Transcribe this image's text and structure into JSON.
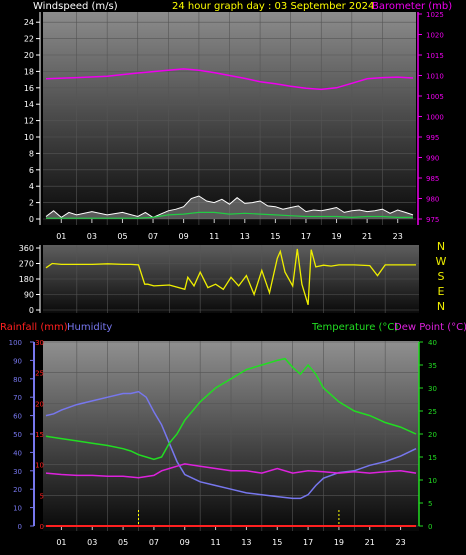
{
  "colors": {
    "wind": "#ffffff",
    "gust": "#ffffff",
    "gust_fill": "#7a7a7a",
    "wind_avg": "#22cc44",
    "barometer": "#ee00ee",
    "direction": "#eeee00",
    "rain": "#ff2020",
    "humidity": "#7777ee",
    "temperature": "#22dd22",
    "dewpoint": "#dd22dd",
    "grid": "#555555"
  },
  "chart_data": [
    {
      "type": "line",
      "title": "24 hour graph day : 03 September 2024",
      "ylabel_left": "Windspeed (m/s)",
      "ylabel_right": "Barometer (mb)",
      "ylim_left": [
        0,
        25
      ],
      "ylim_right": [
        975,
        1025
      ],
      "left_ticks": [
        "0",
        "2",
        "4",
        "6",
        "8",
        "10",
        "12",
        "14",
        "16",
        "18",
        "20",
        "22",
        "24"
      ],
      "right_ticks": [
        "975",
        "980",
        "985",
        "990",
        "995",
        "1000",
        "1005",
        "1010",
        "1015",
        "1020",
        "1025"
      ],
      "x_ticks": [
        "01",
        "03",
        "05",
        "07",
        "09",
        "11",
        "13",
        "15",
        "17",
        "19",
        "21",
        "23"
      ],
      "grid": true,
      "series": [
        {
          "key": "gust",
          "x": [
            0,
            0.5,
            1,
            1.5,
            2,
            3,
            4,
            5,
            6,
            6.5,
            7,
            7.5,
            8,
            8.5,
            9,
            9.5,
            10,
            10.5,
            11,
            11.5,
            12,
            12.5,
            13,
            13.5,
            14,
            14.5,
            15,
            15.5,
            16,
            16.5,
            17,
            17.5,
            18,
            18.5,
            19,
            19.5,
            20,
            20.5,
            21,
            21.5,
            22,
            22.5,
            23,
            23.5,
            24
          ],
          "values": [
            0.3,
            1,
            0.2,
            0.8,
            0.5,
            0.9,
            0.5,
            0.8,
            0.3,
            0.8,
            0.2,
            0.6,
            1,
            1.2,
            1.5,
            2.5,
            2.8,
            2.2,
            2,
            2.4,
            1.8,
            2.6,
            1.9,
            2,
            2.2,
            1.6,
            1.5,
            1.2,
            1.4,
            1.6,
            0.9,
            1.1,
            1,
            1.2,
            1.4,
            0.8,
            1,
            1.1,
            0.9,
            1,
            1.2,
            0.7,
            1.1,
            0.8,
            0.5
          ]
        },
        {
          "key": "wind_avg",
          "x": [
            0,
            2,
            4,
            6,
            7,
            8,
            9,
            10,
            11,
            12,
            13,
            14,
            15,
            16,
            17,
            18,
            19,
            20,
            21,
            22,
            23,
            24
          ],
          "values": [
            0.1,
            0.1,
            0.1,
            0.1,
            0.2,
            0.5,
            0.6,
            0.8,
            0.8,
            0.6,
            0.7,
            0.6,
            0.5,
            0.4,
            0.3,
            0.3,
            0.3,
            0.2,
            0.3,
            0.3,
            0.2,
            0.2
          ]
        },
        {
          "key": "barometer",
          "x": [
            0,
            2,
            4,
            6,
            8,
            9,
            10,
            11,
            12,
            13,
            14,
            15,
            16,
            17,
            18,
            19,
            20,
            21,
            22,
            23,
            24
          ],
          "values": [
            1009.2,
            1009.5,
            1009.8,
            1010.6,
            1011.3,
            1011.6,
            1011.3,
            1010.7,
            1010.0,
            1009.3,
            1008.5,
            1008.0,
            1007.4,
            1006.9,
            1006.6,
            1007.0,
            1008.1,
            1009.2,
            1009.5,
            1009.6,
            1009.4
          ]
        }
      ]
    },
    {
      "type": "line",
      "ylim": [
        0,
        360
      ],
      "y_ticks": [
        "0",
        "90",
        "180",
        "270",
        "360"
      ],
      "compass": [
        "N",
        "W",
        "S",
        "E",
        "N"
      ],
      "x_ticks": [],
      "series": [
        {
          "key": "direction",
          "x": [
            0,
            0.4,
            1,
            2,
            3,
            4,
            5,
            5.5,
            6,
            6.4,
            6.6,
            7,
            8,
            9,
            9.2,
            9.6,
            10,
            10.5,
            11,
            11.5,
            12,
            12.5,
            13,
            13.5,
            14,
            14.5,
            15,
            15.2,
            15.5,
            16,
            16.3,
            16.6,
            17,
            17.2,
            17.5,
            18,
            18.5,
            19,
            20,
            21,
            21.5,
            22,
            23,
            24
          ],
          "values": [
            245,
            270,
            265,
            265,
            265,
            268,
            265,
            265,
            262,
            150,
            150,
            140,
            145,
            120,
            190,
            140,
            220,
            130,
            150,
            120,
            190,
            140,
            200,
            90,
            230,
            100,
            300,
            340,
            220,
            140,
            355,
            150,
            30,
            350,
            250,
            260,
            255,
            262,
            262,
            258,
            200,
            262,
            262,
            262
          ]
        }
      ]
    },
    {
      "type": "line",
      "ylabel_left": "Rainfall (mm)",
      "ylabel_humidity": "Humidity",
      "ylabel_right": "Temperature (°C)",
      "ylabel_dew": "Dew Point (°C)",
      "ylim_humidity": [
        0,
        100
      ],
      "ylim_rain": [
        0,
        30
      ],
      "ylim_temp": [
        0,
        40
      ],
      "humidity_ticks": [
        "0",
        "10",
        "20",
        "30",
        "40",
        "50",
        "60",
        "70",
        "80",
        "90",
        "100"
      ],
      "rain_ticks": [
        "0",
        "5",
        "10",
        "15",
        "20",
        "25",
        "30"
      ],
      "temp_ticks": [
        "0",
        "5",
        "10",
        "15",
        "20",
        "25",
        "30",
        "35",
        "40"
      ],
      "x_ticks": [
        "01",
        "03",
        "05",
        "07",
        "09",
        "11",
        "13",
        "15",
        "17",
        "19",
        "21",
        "23"
      ],
      "series": [
        {
          "key": "humidity",
          "x": [
            0,
            0.5,
            1,
            2,
            3,
            4,
            5,
            5.5,
            6,
            6.5,
            7,
            7.5,
            8,
            8.5,
            9,
            10,
            11,
            12,
            13,
            14,
            15,
            16,
            16.5,
            17,
            17.5,
            18,
            19,
            20,
            21,
            22,
            23,
            24
          ],
          "values": [
            60,
            61,
            63,
            66,
            68,
            70,
            72,
            72,
            73,
            70,
            62,
            55,
            45,
            35,
            28,
            24,
            22,
            20,
            18,
            17,
            16,
            15,
            15,
            17,
            22,
            26,
            29,
            30,
            33,
            35,
            38,
            42
          ]
        },
        {
          "key": "temperature",
          "x": [
            0,
            1,
            2,
            3,
            4,
            5,
            5.5,
            6,
            6.5,
            7,
            7.5,
            8,
            8.5,
            9,
            10,
            11,
            12,
            13,
            14,
            15,
            15.5,
            16,
            16.5,
            17,
            17.5,
            18,
            19,
            20,
            21,
            22,
            23,
            24
          ],
          "values": [
            19.5,
            19,
            18.5,
            18,
            17.5,
            16.8,
            16.3,
            15.5,
            15,
            14.5,
            15,
            18,
            20,
            23,
            27,
            30,
            32,
            34,
            35,
            36,
            36.4,
            34.5,
            33,
            35,
            33,
            30,
            27,
            25,
            24,
            22.5,
            21.5,
            20
          ]
        },
        {
          "key": "dewpoint",
          "x": [
            0,
            1,
            2,
            3,
            4,
            5,
            6,
            7,
            7.5,
            8,
            8.5,
            9,
            10,
            11,
            12,
            13,
            14,
            15,
            16,
            17,
            18,
            19,
            20,
            21,
            22,
            23,
            24
          ],
          "values": [
            11.5,
            11.2,
            11,
            11,
            10.8,
            10.8,
            10.5,
            11,
            12,
            12.5,
            13,
            13.5,
            13,
            12.5,
            12,
            12,
            11.5,
            12.5,
            11.5,
            12,
            11.8,
            11.5,
            11.8,
            11.5,
            11.8,
            12,
            11.5
          ]
        },
        {
          "key": "rain",
          "x": [
            0,
            24
          ],
          "values": [
            0,
            0
          ]
        }
      ],
      "markers_x": [
        6,
        19
      ]
    }
  ]
}
